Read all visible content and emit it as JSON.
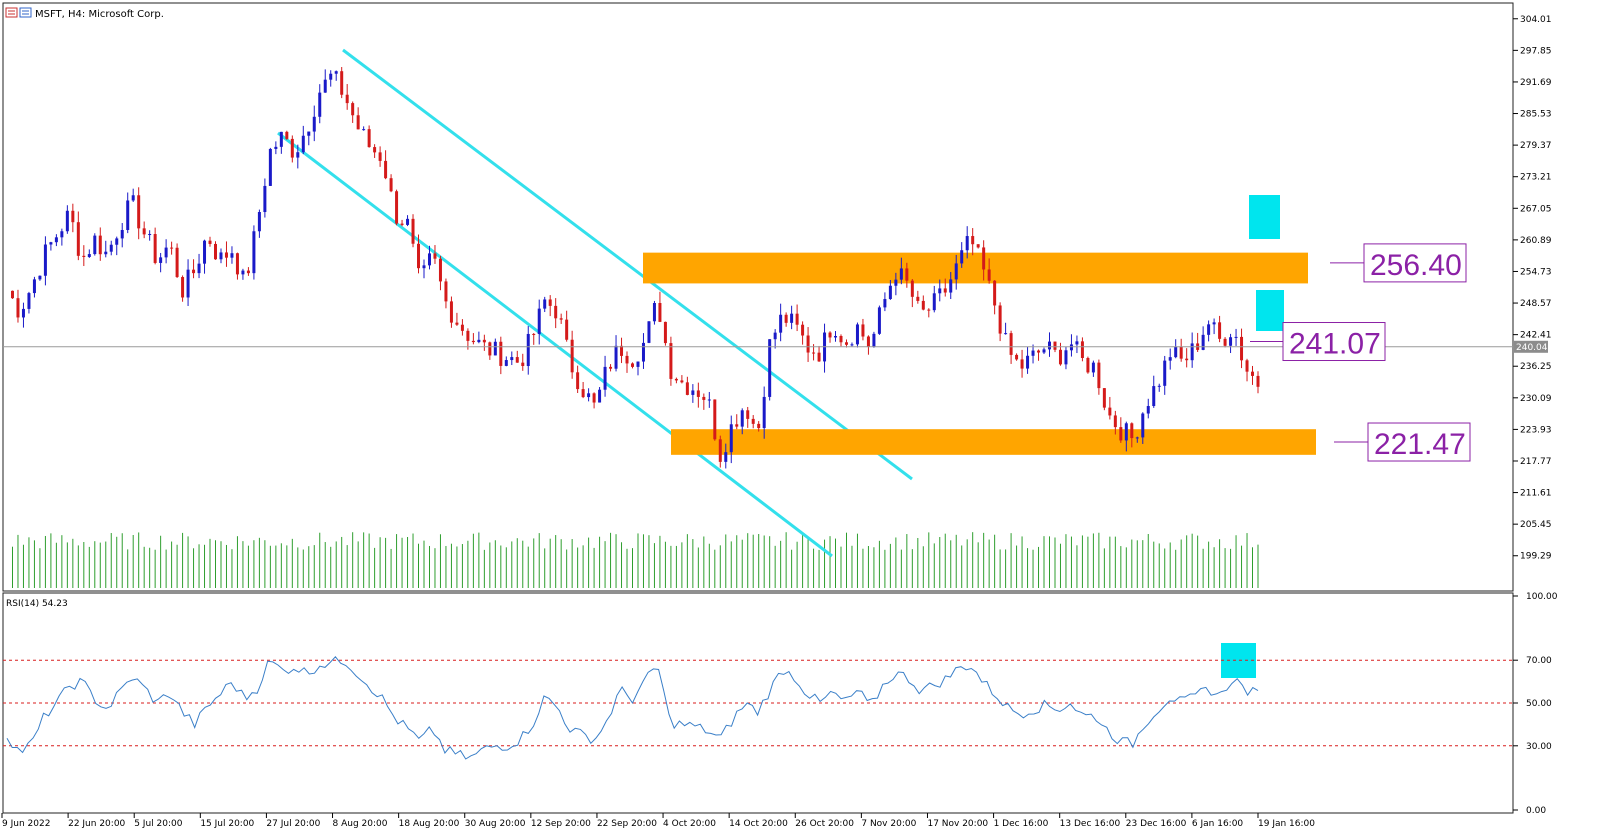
{
  "header": {
    "title": "MSFT, H4:  Microsoft Corp.",
    "icon": "chart-menu-icon"
  },
  "colors": {
    "bull": "#1a1ac8",
    "bear": "#d41a1a",
    "volume": "#2e9e2e",
    "channel": "#33e0ec",
    "zone": "#ffa500",
    "marker": "#00e5ee",
    "label": "#8b21a6",
    "rsi_line": "#3a7fc8",
    "rsi_levels": "#d81e1e"
  },
  "chart_data": [
    {
      "type": "candlestick",
      "symbol": "MSFT",
      "timeframe": "H4",
      "title": "MSFT, H4:  Microsoft Corp.",
      "ylim": [
        193.0,
        306.5
      ],
      "y_ticks": [
        "304.01",
        "297.85",
        "291.69",
        "285.53",
        "279.37",
        "273.21",
        "267.05",
        "260.89",
        "254.73",
        "248.57",
        "242.41",
        "236.25",
        "230.09",
        "223.93",
        "217.77",
        "211.61",
        "205.45",
        "199.29"
      ],
      "x_ticks": [
        "9 Jun 2022",
        "22 Jun 20:00",
        "5 Jul 20:00",
        "15 Jul 20:00",
        "27 Jul 20:00",
        "8 Aug 20:00",
        "18 Aug 20:00",
        "30 Aug 20:00",
        "12 Sep 20:00",
        "22 Sep 20:00",
        "4 Oct 20:00",
        "14 Oct 20:00",
        "26 Oct 20:00",
        "7 Nov 20:00",
        "17 Nov 20:00",
        "1 Dec 16:00",
        "13 Dec 16:00",
        "23 Dec 16:00",
        "6 Jan 16:00",
        "19 Jan 16:00"
      ],
      "current_price": "240.04",
      "price_path": [
        251,
        247,
        252,
        258,
        262,
        266,
        257,
        261,
        258,
        264,
        268,
        262,
        257,
        260,
        251,
        255,
        262,
        257,
        259,
        252,
        264,
        278,
        281,
        278,
        283,
        290,
        293,
        289,
        283,
        279,
        277,
        266,
        264,
        252,
        258,
        249,
        245,
        242,
        240,
        239,
        238,
        237,
        242,
        249,
        247,
        237,
        232,
        228,
        236,
        240,
        238,
        241,
        249,
        236,
        233,
        232,
        230,
        219,
        225,
        229,
        223,
        241,
        246,
        244,
        240,
        239,
        245,
        241,
        244,
        240,
        248,
        255,
        252,
        246,
        248,
        251,
        256,
        261,
        255,
        248,
        239,
        236,
        238,
        240,
        238,
        241,
        237,
        236,
        227,
        224,
        222,
        229,
        233,
        239,
        237,
        240,
        245,
        241,
        244,
        236,
        233
      ],
      "volume": "uniform bars",
      "annotations": {
        "resistance_zone": "256.40",
        "mid_level": "241.07",
        "support_zone": "221.47"
      }
    },
    {
      "type": "line",
      "indicator": "RSI(14) 54.23",
      "ylim": [
        0,
        100
      ],
      "y_ticks": [
        "100.00",
        "70.00",
        "50.00",
        "30.00",
        "0.00"
      ],
      "levels": [
        70,
        50,
        30
      ],
      "values": [
        35,
        27,
        31,
        44,
        50,
        58,
        60,
        52,
        47,
        55,
        62,
        57,
        50,
        55,
        46,
        40,
        48,
        54,
        60,
        52,
        57,
        70,
        65,
        67,
        64,
        68,
        69,
        70,
        64,
        58,
        52,
        43,
        38,
        32,
        38,
        28,
        26,
        24,
        28,
        30,
        30,
        33,
        40,
        53,
        48,
        38,
        35,
        33,
        42,
        56,
        52,
        60,
        68,
        41,
        40,
        39,
        37,
        33,
        42,
        50,
        46,
        56,
        66,
        62,
        54,
        50,
        55,
        50,
        56,
        48,
        58,
        64,
        62,
        56,
        58,
        61,
        66,
        68,
        60,
        54,
        48,
        45,
        47,
        49,
        47,
        50,
        44,
        44,
        37,
        32,
        31,
        41,
        47,
        53,
        50,
        53,
        57,
        53,
        62,
        56,
        54
      ]
    }
  ]
}
